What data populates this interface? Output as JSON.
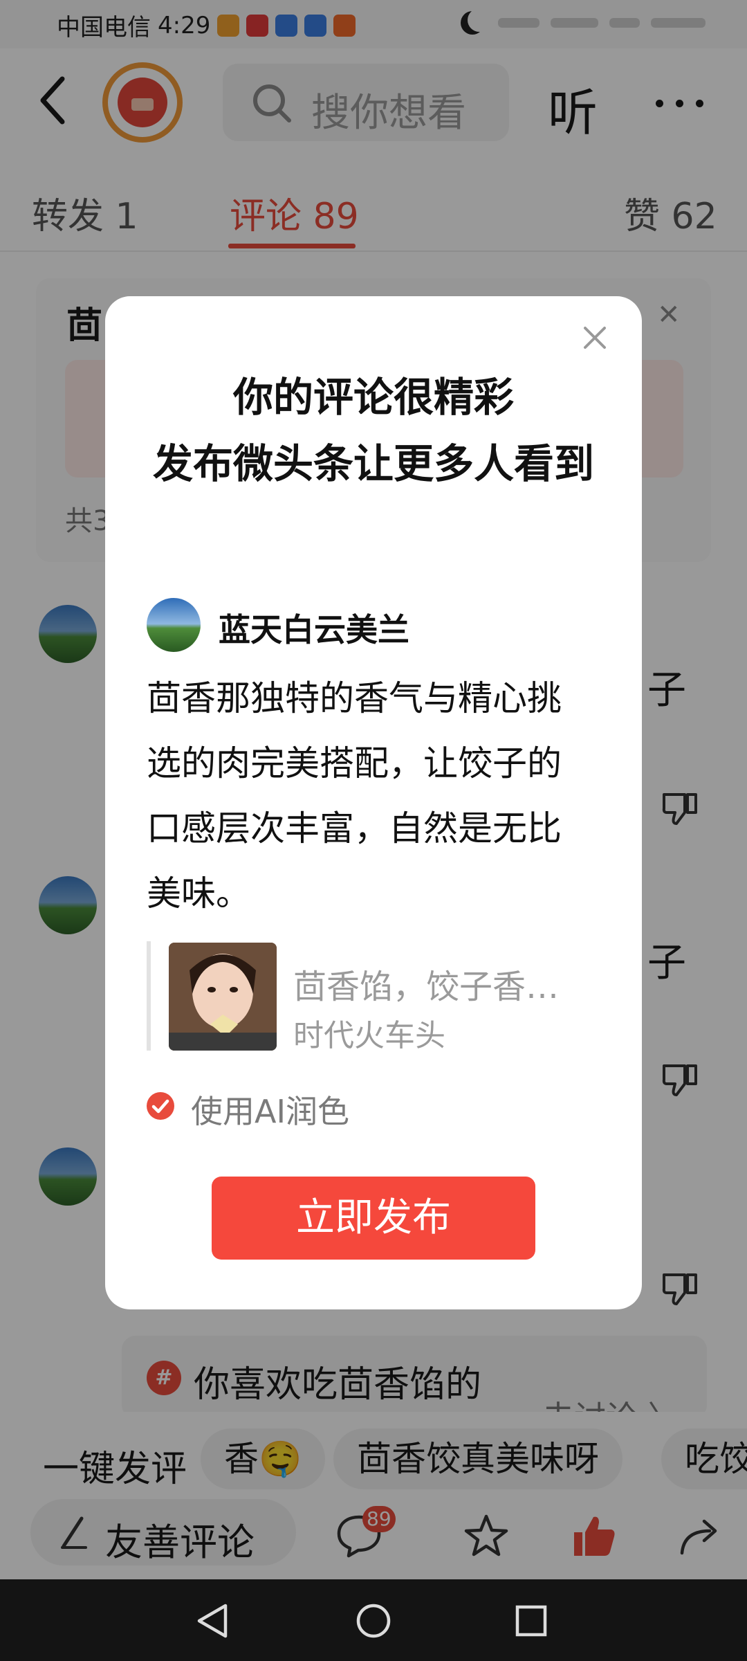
{
  "status_bar": {
    "carrier": "中国电信",
    "time": "4:29"
  },
  "header": {
    "search_placeholder": "搜你想看",
    "listen_label": "听"
  },
  "tabs": [
    {
      "label": "转发 1"
    },
    {
      "label": "评论 89"
    },
    {
      "label": "赞 62"
    }
  ],
  "background": {
    "card_title": "茴",
    "card_count": "共3",
    "side_text_1": "子",
    "side_text_2": "子",
    "topic_text": "你喜欢吃茴香馅的",
    "topic_link": "去讨论 〉"
  },
  "quick_replies": {
    "label": "一键发评",
    "chips": [
      "香🤤",
      "茴香饺真美味呀",
      "吃饺"
    ]
  },
  "bottom_bar": {
    "write_placeholder": "友善评论",
    "comment_count": "89"
  },
  "dialog": {
    "title": "你的评论很精彩\n发布微头条让更多人看到",
    "user_name": "蓝天白云美兰",
    "comment_text": "茴香那独特的香气与精心挑选的肉完美搭配，让饺子的口感层次丰富，自然是无比美味。",
    "quote_title": "茴香馅，饺子香…",
    "quote_source": "时代火车头",
    "ai_option_label": "使用AI润色",
    "ai_option_checked": true,
    "publish_label": "立即发布"
  },
  "colors": {
    "accent": "#e84b3c",
    "publish_button": "#f5483c"
  }
}
